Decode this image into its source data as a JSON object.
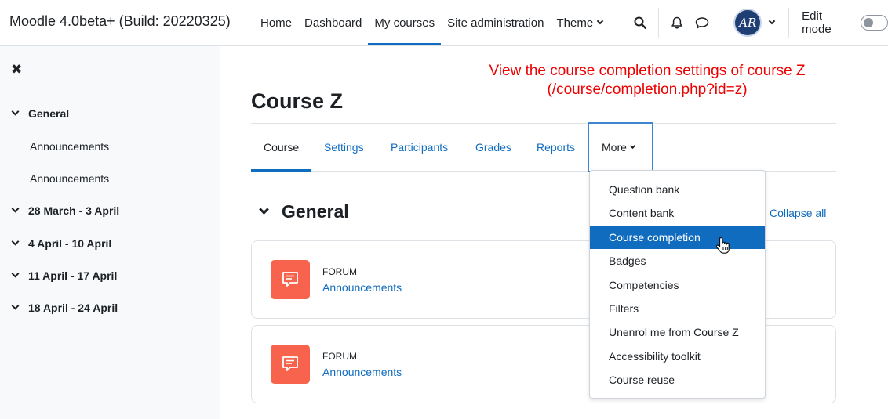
{
  "navbar": {
    "brand": "Moodle 4.0beta+ (Build: 20220325)",
    "items": [
      {
        "label": "Home"
      },
      {
        "label": "Dashboard"
      },
      {
        "label": "My courses"
      },
      {
        "label": "Site administration"
      },
      {
        "label": "Theme"
      }
    ],
    "active_item": "My courses",
    "icons": [
      "search-icon",
      "bell-icon",
      "messages-icon"
    ],
    "user_initials": "AR",
    "edit_mode_label": "Edit mode",
    "edit_mode_on": false
  },
  "drawer": {
    "close_icon": "close-icon",
    "items": [
      {
        "label": "General",
        "type": "section"
      },
      {
        "label": "Announcements",
        "type": "link"
      },
      {
        "label": "Announcements",
        "type": "link"
      },
      {
        "label": "28 March - 3 April",
        "type": "section"
      },
      {
        "label": "4 April - 10 April",
        "type": "section"
      },
      {
        "label": "11 April - 17 April",
        "type": "section"
      },
      {
        "label": "18 April - 24 April",
        "type": "section"
      }
    ]
  },
  "annotation": "View the course completion settings of course Z (/course/completion.php?id=z)",
  "course": {
    "title": "Course Z",
    "tabs": [
      {
        "label": "Course"
      },
      {
        "label": "Settings"
      },
      {
        "label": "Participants"
      },
      {
        "label": "Grades"
      },
      {
        "label": "Reports"
      },
      {
        "label": "More"
      }
    ],
    "active_tab": "Course"
  },
  "section": {
    "title": "General",
    "collapse_all": "Collapse all"
  },
  "activities": [
    {
      "type": "FORUM",
      "name": "Announcements"
    },
    {
      "type": "FORUM",
      "name": "Announcements"
    }
  ],
  "more_menu": {
    "items": [
      {
        "label": "Question bank"
      },
      {
        "label": "Content bank"
      },
      {
        "label": "Course completion"
      },
      {
        "label": "Badges"
      },
      {
        "label": "Competencies"
      },
      {
        "label": "Filters"
      },
      {
        "label": "Unenrol me from Course Z"
      },
      {
        "label": "Accessibility toolkit"
      },
      {
        "label": "Course reuse"
      }
    ],
    "highlighted": "Course completion"
  },
  "colors": {
    "primary": "#0f6cbf",
    "forum_icon_bg": "#f7634d",
    "annotation": "#ee0000"
  }
}
